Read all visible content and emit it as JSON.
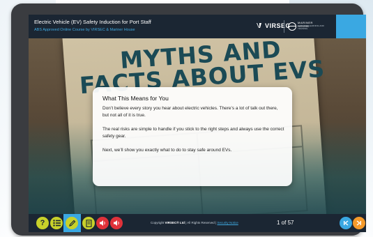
{
  "header": {
    "course_title": "Electric Vehicle (EV) Safety Induction for Port Staff",
    "course_subtitle": "ABS Approved Online Course by VIRSEC & Mariner House",
    "brand_logo": "VIRSEC",
    "partner_logo_line1": "MARINER HOUSE",
    "partner_logo_line2": "MARITIME LEARNING AND TRAINING"
  },
  "slide": {
    "background_title": "MYTHS AND FACTS ABOUT EVS",
    "card": {
      "title": "What This Means for You",
      "paragraphs": [
        "Don’t believe every story you hear about electric vehicles. There’s a lot of talk out there, but not all of it is true.",
        "The real risks are simple to handle if you stick to the right steps and always use the correct safety gear.",
        "Next, we’ll show you exactly what to do to stay safe around EVs."
      ]
    }
  },
  "footer": {
    "buttons": [
      {
        "name": "help-button",
        "icon": "question-icon"
      },
      {
        "name": "menu-button",
        "icon": "list-icon"
      },
      {
        "name": "notes-button",
        "icon": "pencil-icon"
      },
      {
        "name": "transcript-button",
        "icon": "document-icon"
      },
      {
        "name": "audio-button",
        "icon": "speaker-icon"
      },
      {
        "name": "audio-button-2",
        "icon": "speaker-icon"
      }
    ],
    "copyright_prefix": "Copyright",
    "copyright_brand": "VIRSEC® Ltd",
    "copyright_suffix": " | All Rights Reserved |",
    "security_link": "Security Notice",
    "page_indicator": "1 of 57"
  },
  "colors": {
    "accent_blue": "#3aa8e2",
    "accent_lime": "#c8d12a",
    "accent_red": "#e0323a",
    "accent_orange": "#f59a2a",
    "header_bg": "#1b2633"
  }
}
